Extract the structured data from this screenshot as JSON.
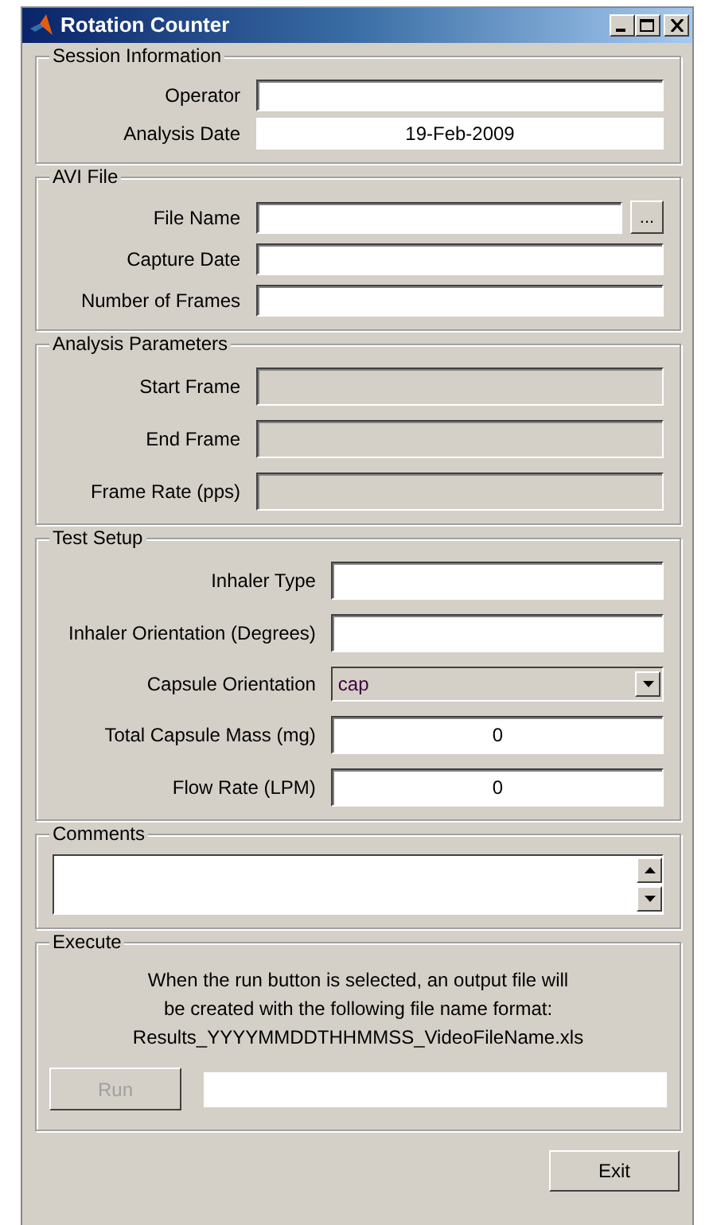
{
  "window": {
    "title": "Rotation Counter"
  },
  "sections": [
    {
      "title": "Session Information",
      "rows": [
        {
          "kind": "input",
          "label": "Operator",
          "value": "",
          "disabled": false
        },
        {
          "kind": "text",
          "label": "Analysis Date",
          "value": "19-Feb-2009"
        }
      ]
    },
    {
      "title": "AVI File",
      "rows": [
        {
          "kind": "input",
          "label": "File Name",
          "value": "",
          "disabled": false,
          "browse_button": "..."
        },
        {
          "kind": "input",
          "label": "Capture Date",
          "value": "",
          "disabled": false
        },
        {
          "kind": "input",
          "label": "Number of Frames",
          "value": "",
          "disabled": false
        }
      ]
    },
    {
      "title": "Analysis Parameters",
      "rows": [
        {
          "kind": "input",
          "label": "Start Frame",
          "value": "",
          "disabled": true
        },
        {
          "kind": "input",
          "label": "End Frame",
          "value": "",
          "disabled": true
        },
        {
          "kind": "input",
          "label": "Frame Rate (pps)",
          "value": "",
          "disabled": true
        }
      ]
    },
    {
      "title": "Test Setup",
      "rows": [
        {
          "kind": "input",
          "label": "Inhaler Type",
          "value": "",
          "disabled": false
        },
        {
          "kind": "input",
          "label": "Inhaler Orientation (Degrees)",
          "value": "",
          "disabled": false
        },
        {
          "kind": "select",
          "label": "Capsule Orientation",
          "value": "cap"
        },
        {
          "kind": "input",
          "label": "Total Capsule Mass (mg)",
          "value": "0",
          "disabled": false
        },
        {
          "kind": "input",
          "label": "Flow Rate (LPM)",
          "value": "0",
          "disabled": false
        }
      ]
    }
  ],
  "comments": {
    "title": "Comments"
  },
  "execute": {
    "title": "Execute",
    "message_lines": [
      "When the run button is selected, an output file will",
      "be created with the following file name format:",
      "Results_YYYYMMDDTHHMMSS_VideoFileName.xls"
    ],
    "run_button": {
      "label": "Run",
      "disabled": true
    }
  },
  "exit_button": "Exit"
}
